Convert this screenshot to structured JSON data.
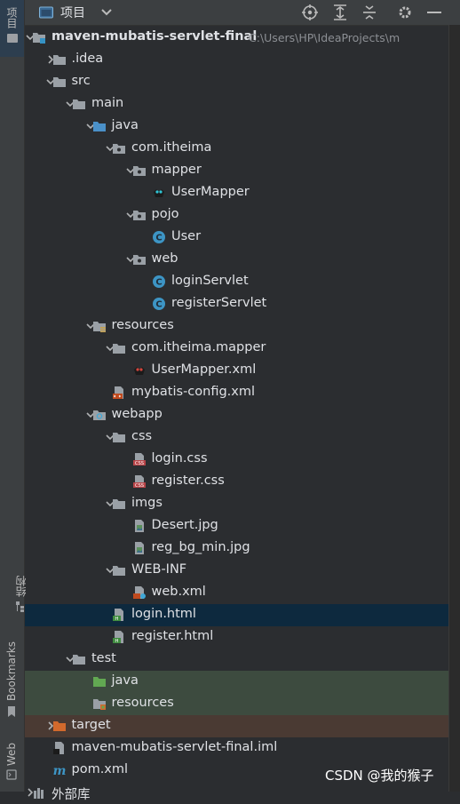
{
  "sidebar": {
    "project_tab": "项目",
    "structure_tab": "结构",
    "bookmarks_tab": "Bookmarks",
    "web_tab": "Web"
  },
  "header": {
    "title": "项目"
  },
  "tree": [
    {
      "depth": 0,
      "chev": "down",
      "icon": "module-folder",
      "label": "maven-mubatis-servlet-final",
      "bold": true,
      "path": "C:\\Users\\HP\\IdeaProjects\\m"
    },
    {
      "depth": 1,
      "chev": "right",
      "icon": "folder",
      "label": ".idea"
    },
    {
      "depth": 1,
      "chev": "down",
      "icon": "folder",
      "label": "src"
    },
    {
      "depth": 2,
      "chev": "down",
      "icon": "folder",
      "label": "main"
    },
    {
      "depth": 3,
      "chev": "down",
      "icon": "source-folder",
      "label": "java"
    },
    {
      "depth": 4,
      "chev": "down",
      "icon": "package",
      "label": "com.itheima"
    },
    {
      "depth": 5,
      "chev": "down",
      "icon": "package",
      "label": "mapper"
    },
    {
      "depth": 6,
      "chev": "none",
      "icon": "mybatis",
      "label": "UserMapper"
    },
    {
      "depth": 5,
      "chev": "down",
      "icon": "package",
      "label": "pojo"
    },
    {
      "depth": 6,
      "chev": "none",
      "icon": "class",
      "label": "User"
    },
    {
      "depth": 5,
      "chev": "down",
      "icon": "package",
      "label": "web"
    },
    {
      "depth": 6,
      "chev": "none",
      "icon": "class",
      "label": "loginServlet"
    },
    {
      "depth": 6,
      "chev": "none",
      "icon": "class",
      "label": "registerServlet"
    },
    {
      "depth": 3,
      "chev": "down",
      "icon": "resources-folder",
      "label": "resources"
    },
    {
      "depth": 4,
      "chev": "down",
      "icon": "folder",
      "label": "com.itheima.mapper"
    },
    {
      "depth": 5,
      "chev": "none",
      "icon": "mybatis-xml",
      "label": "UserMapper.xml"
    },
    {
      "depth": 4,
      "chev": "none",
      "icon": "xml",
      "label": "mybatis-config.xml"
    },
    {
      "depth": 3,
      "chev": "down",
      "icon": "web-folder",
      "label": "webapp"
    },
    {
      "depth": 4,
      "chev": "down",
      "icon": "folder",
      "label": "css"
    },
    {
      "depth": 5,
      "chev": "none",
      "icon": "css",
      "label": "login.css"
    },
    {
      "depth": 5,
      "chev": "none",
      "icon": "css",
      "label": "register.css"
    },
    {
      "depth": 4,
      "chev": "down",
      "icon": "folder",
      "label": "imgs"
    },
    {
      "depth": 5,
      "chev": "none",
      "icon": "image",
      "label": "Desert.jpg"
    },
    {
      "depth": 5,
      "chev": "none",
      "icon": "image",
      "label": "reg_bg_min.jpg"
    },
    {
      "depth": 4,
      "chev": "down",
      "icon": "folder",
      "label": "WEB-INF"
    },
    {
      "depth": 5,
      "chev": "none",
      "icon": "web-xml",
      "label": "web.xml"
    },
    {
      "depth": 4,
      "chev": "none",
      "icon": "html",
      "label": "login.html",
      "state": "selected"
    },
    {
      "depth": 4,
      "chev": "none",
      "icon": "html",
      "label": "register.html"
    },
    {
      "depth": 2,
      "chev": "down",
      "icon": "folder",
      "label": "test"
    },
    {
      "depth": 3,
      "chev": "none",
      "icon": "test-folder",
      "label": "java",
      "state": "test-src"
    },
    {
      "depth": 3,
      "chev": "none",
      "icon": "test-resources",
      "label": "resources",
      "state": "test-src"
    },
    {
      "depth": 1,
      "chev": "right",
      "icon": "excluded-folder",
      "label": "target",
      "state": "excluded"
    },
    {
      "depth": 1,
      "chev": "none",
      "icon": "iml",
      "label": "maven-mubatis-servlet-final.iml"
    },
    {
      "depth": 1,
      "chev": "none",
      "icon": "maven",
      "label": "pom.xml"
    },
    {
      "depth": 0,
      "chev": "right",
      "icon": "libraries",
      "label": "外部库"
    }
  ],
  "colors": {
    "background": "#2b2d30",
    "selected_row": "#0d293e",
    "test_row": "#3d4b3f",
    "excluded_row": "#4a3a33",
    "folder": "#9aa0a6",
    "source_folder": "#4a90c8",
    "test_folder": "#62a852",
    "excluded_folder": "#d2692c",
    "class_icon": "#3d95c5",
    "html_icon": "#3f8b3f",
    "css_icon": "#b84448"
  },
  "watermark": "CSDN @我的猴子"
}
